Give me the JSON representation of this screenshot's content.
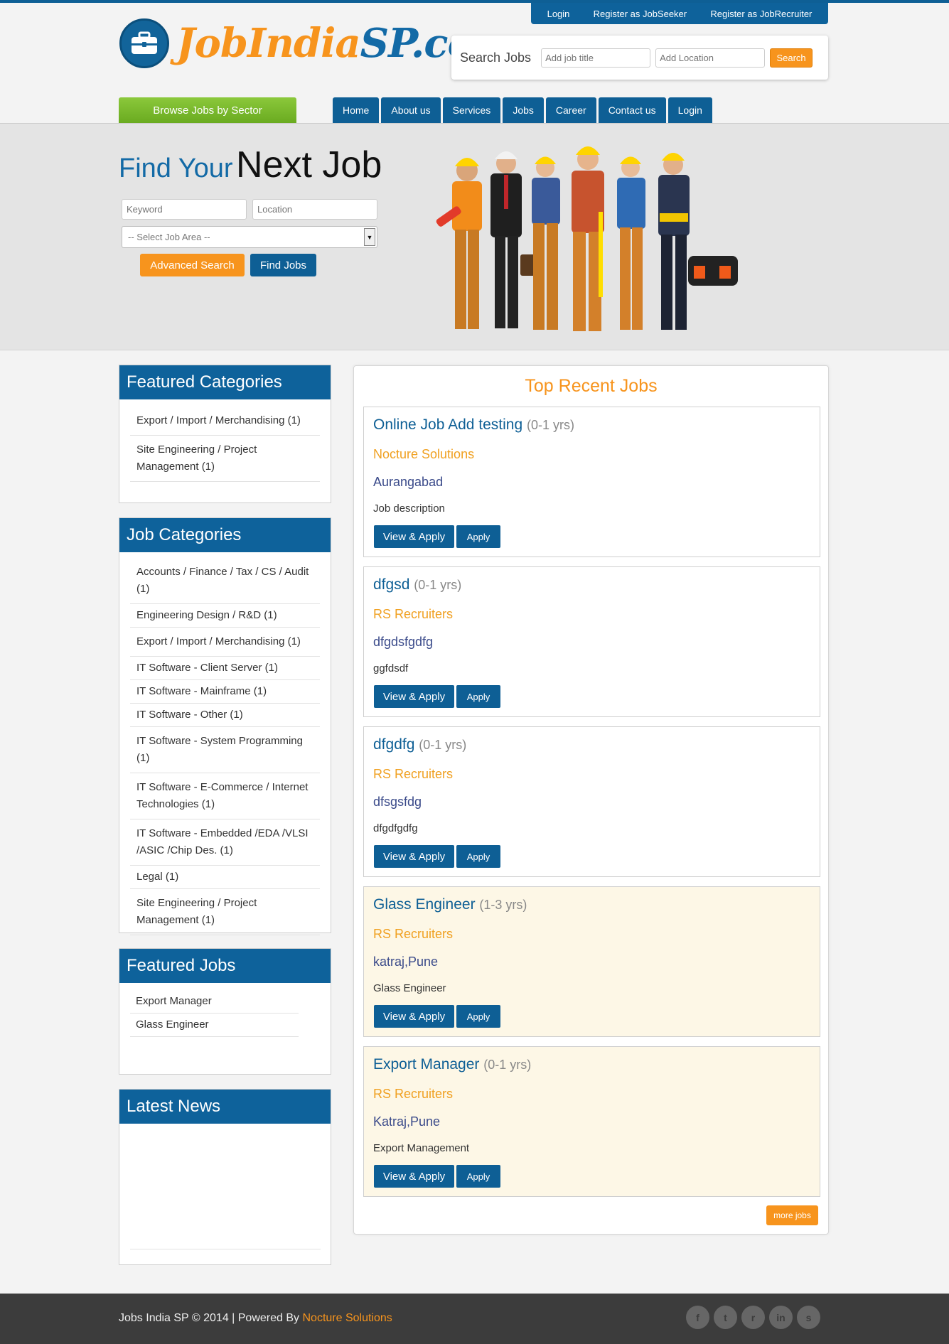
{
  "top_links": [
    "Login",
    "Register as JobSeeker",
    "Register as JobRecruiter"
  ],
  "logo": {
    "part1": "JobIndia",
    "part2": "SP.com"
  },
  "header_search": {
    "label": "Search Jobs",
    "title_placeholder": "Add job title",
    "location_placeholder": "Add Location",
    "button": "Search"
  },
  "browse_button": "Browse Jobs by Sector",
  "main_nav": [
    "Home",
    "About us",
    "Services",
    "Jobs",
    "Career",
    "Contact us",
    "Login"
  ],
  "hero": {
    "title_part1": "Find Your",
    "title_part2": "Next Job",
    "keyword_placeholder": "Keyword",
    "location_placeholder": "Location",
    "select_default": "-- Select Job Area --",
    "advanced_button": "Advanced Search",
    "find_button": "Find Jobs"
  },
  "featured_categories": {
    "title": "Featured Categories",
    "items": [
      "Export / Import / Merchandising (1)",
      "Site Engineering / Project Management (1)"
    ]
  },
  "job_categories": {
    "title": "Job Categories",
    "items": [
      "Accounts / Finance / Tax / CS / Audit (1)",
      "Engineering Design / R&D (1)",
      "Export / Import / Merchandising (1)",
      "IT Software - Client Server (1)",
      "IT Software - Mainframe (1)",
      "IT Software - Other (1)",
      "IT Software - System Programming (1)",
      "IT Software - E-Commerce / Internet Technologies (1)",
      "IT Software - Embedded /EDA /VLSI /ASIC /Chip Des. (1)",
      "Legal (1)",
      "Site Engineering / Project Management (1)"
    ]
  },
  "featured_jobs": {
    "title": "Featured Jobs",
    "items": [
      "Export Manager",
      "Glass Engineer"
    ]
  },
  "latest_news": {
    "title": "Latest News"
  },
  "recent_jobs": {
    "title": "Top Recent Jobs",
    "view_label": "View & Apply",
    "apply_label": "Apply",
    "more_label": "more jobs",
    "jobs": [
      {
        "title": "Online Job Add testing",
        "exp": "(0-1 yrs)",
        "company": "Nocture Solutions",
        "location": "Aurangabad",
        "desc": "Job description"
      },
      {
        "title": "dfgsd",
        "exp": "(0-1 yrs)",
        "company": "RS Recruiters",
        "location": "dfgdsfgdfg",
        "desc": "ggfdsdf"
      },
      {
        "title": "dfgdfg",
        "exp": "(0-1 yrs)",
        "company": "RS Recruiters",
        "location": "dfsgsfdg",
        "desc": "dfgdfgdfg"
      },
      {
        "title": "Glass Engineer",
        "exp": "(1-3 yrs)",
        "company": "RS Recruiters",
        "location": "katraj,Pune",
        "desc": "Glass Engineer"
      },
      {
        "title": "Export Manager",
        "exp": "(0-1 yrs)",
        "company": "RS Recruiters",
        "location": "Katraj,Pune",
        "desc": "Export Management"
      }
    ]
  },
  "footer": {
    "text": "Jobs India SP © 2014 | Powered By",
    "link": "Nocture Solutions",
    "socials": [
      "facebook-icon",
      "twitter-icon",
      "rss-icon",
      "linkedin-icon",
      "skype-icon"
    ],
    "social_glyphs": [
      "f",
      "t",
      "r",
      "in",
      "s"
    ]
  },
  "colors": {
    "primary": "#0e5f95",
    "accent": "#f7941d",
    "green": "#7ab82e"
  }
}
